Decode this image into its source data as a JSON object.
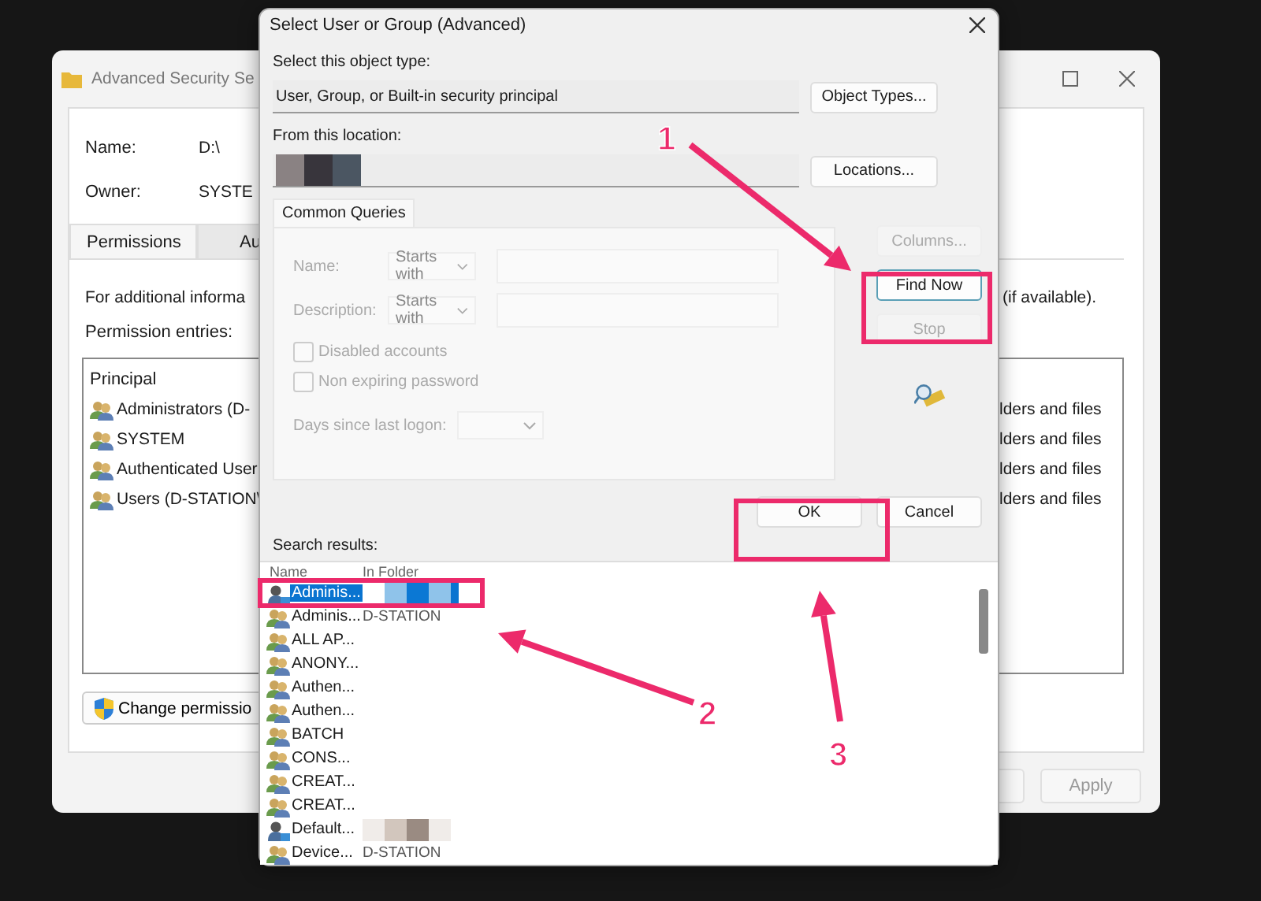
{
  "back_window": {
    "title": "Advanced Security Se",
    "fields": [
      {
        "label": "Name:",
        "value": "D:\\"
      },
      {
        "label": "Owner:",
        "value": "SYSTE"
      }
    ],
    "tabs": [
      {
        "label": "Permissions",
        "selected": true
      },
      {
        "label": "Au",
        "selected": false
      }
    ],
    "info_left": "For additional informa",
    "info_right": "(if available).",
    "entries_label": "Permission entries:",
    "list_header": "Principal",
    "entries": [
      {
        "principal": "Administrators (D-",
        "applies_to": "lders and files"
      },
      {
        "principal": "SYSTEM",
        "applies_to": "lders and files"
      },
      {
        "principal": "Authenticated User",
        "applies_to": "lders and files"
      },
      {
        "principal": "Users (D-STATION\\",
        "applies_to": "lders and files"
      }
    ],
    "change_button": "Change permissio",
    "apply_button": {
      "label": "Apply",
      "disabled": true
    }
  },
  "dialog": {
    "title": "Select User or Group (Advanced)",
    "object_type_label": "Select this object type:",
    "object_type_value": "User, Group, or Built-in security principal",
    "object_types_button": "Object Types...",
    "location_label": "From this location:",
    "locations_button": "Locations...",
    "common_queries": {
      "tab": "Common Queries",
      "disabled": true,
      "fields": [
        {
          "label": "Name:",
          "operator": "Starts with"
        },
        {
          "label": "Description:",
          "operator": "Starts with"
        }
      ],
      "checkboxes": [
        {
          "label": "Disabled accounts",
          "checked": false
        },
        {
          "label": "Non expiring password",
          "checked": false
        }
      ],
      "days_label": "Days since last logon:"
    },
    "side_buttons": [
      {
        "label": "Columns...",
        "disabled": true,
        "default": false
      },
      {
        "label": "Find Now",
        "disabled": false,
        "default": true
      },
      {
        "label": "Stop",
        "disabled": true,
        "default": false
      }
    ],
    "ok_button": "OK",
    "cancel_button": "Cancel",
    "results_label": "Search results:",
    "results_columns": [
      "Name",
      "In Folder"
    ],
    "results": [
      {
        "name": "Adminis...",
        "kind": "user",
        "selected": true,
        "folder_masked": true
      },
      {
        "name": "Adminis...",
        "kind": "group",
        "selected": false,
        "folder_masked": false,
        "in_folder": "D-STATION"
      },
      {
        "name": "ALL AP...",
        "kind": "group",
        "selected": false,
        "folder_masked": false
      },
      {
        "name": "ANONY...",
        "kind": "group",
        "selected": false,
        "folder_masked": false
      },
      {
        "name": "Authen...",
        "kind": "group",
        "selected": false,
        "folder_masked": false
      },
      {
        "name": "Authen...",
        "kind": "group",
        "selected": false,
        "folder_masked": false
      },
      {
        "name": "BATCH",
        "kind": "group",
        "selected": false,
        "folder_masked": false
      },
      {
        "name": "CONS...",
        "kind": "group",
        "selected": false,
        "folder_masked": false
      },
      {
        "name": "CREAT...",
        "kind": "group",
        "selected": false,
        "folder_masked": false
      },
      {
        "name": "CREAT...",
        "kind": "group",
        "selected": false,
        "folder_masked": false
      },
      {
        "name": "Default...",
        "kind": "user",
        "selected": false,
        "folder_masked": true
      },
      {
        "name": "Device...",
        "kind": "group",
        "selected": false,
        "folder_masked": false,
        "in_folder": "D-STATION"
      }
    ]
  },
  "annotations": [
    {
      "label": "1"
    },
    {
      "label": "2"
    },
    {
      "label": "3"
    }
  ]
}
